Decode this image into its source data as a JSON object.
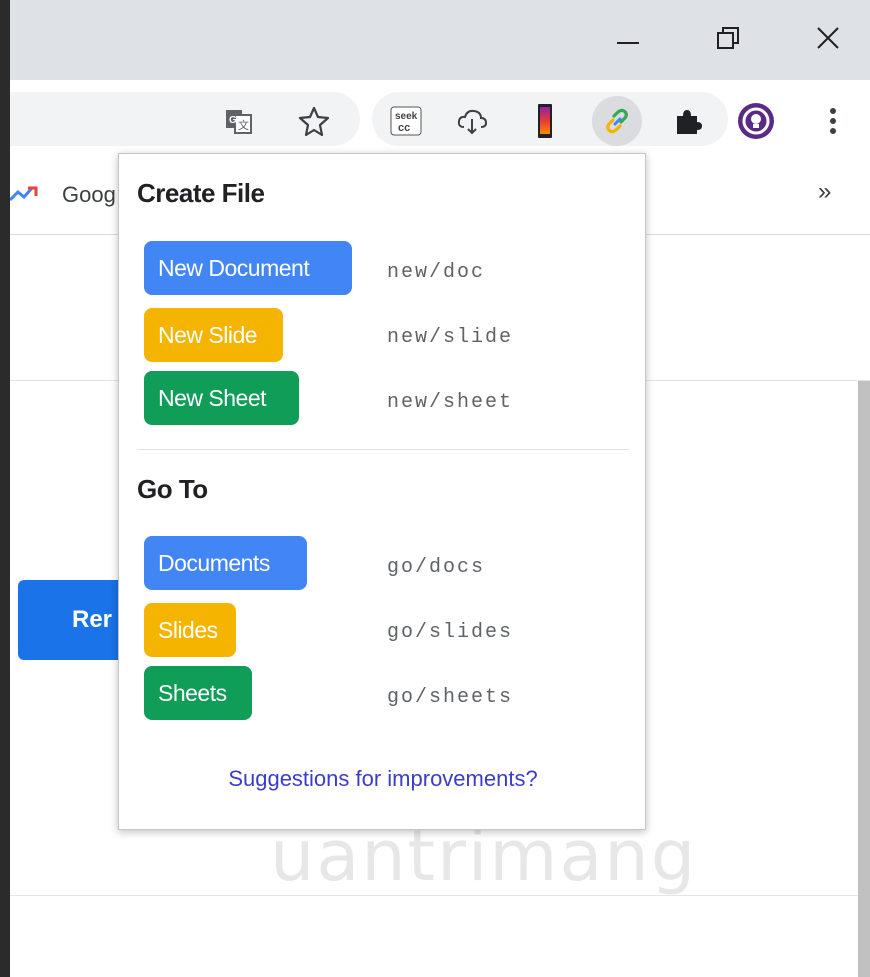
{
  "bookmarks_bar": {
    "visible_label": "Goog",
    "overflow": "»"
  },
  "page": {
    "button_fragment": "Rer",
    "watermark": "uantrimang"
  },
  "popup": {
    "create_title": "Create File",
    "create_items": [
      {
        "label": "New Document",
        "shortcut": "new/doc",
        "color": "#4285f4"
      },
      {
        "label": "New Slide",
        "shortcut": "new/slide",
        "color": "#f4b400"
      },
      {
        "label": "New Sheet",
        "shortcut": "new/sheet",
        "color": "#0f9d58"
      }
    ],
    "goto_title": "Go To",
    "goto_items": [
      {
        "label": "Documents",
        "shortcut": "go/docs",
        "color": "#4285f4"
      },
      {
        "label": "Slides",
        "shortcut": "go/slides",
        "color": "#f4b400"
      },
      {
        "label": "Sheets",
        "shortcut": "go/sheets",
        "color": "#0f9d58"
      }
    ],
    "suggestions_link": "Suggestions for improvements?"
  },
  "toolbar": {
    "icons": [
      "translate-icon",
      "bookmark-star-icon",
      "seek-cc-icon",
      "cloud-download-icon",
      "phone-gradient-icon",
      "link-icon",
      "puzzle-extensions-icon",
      "profile-avatar-icon",
      "more-menu-icon"
    ],
    "seek_cc": "seek\ncc"
  }
}
